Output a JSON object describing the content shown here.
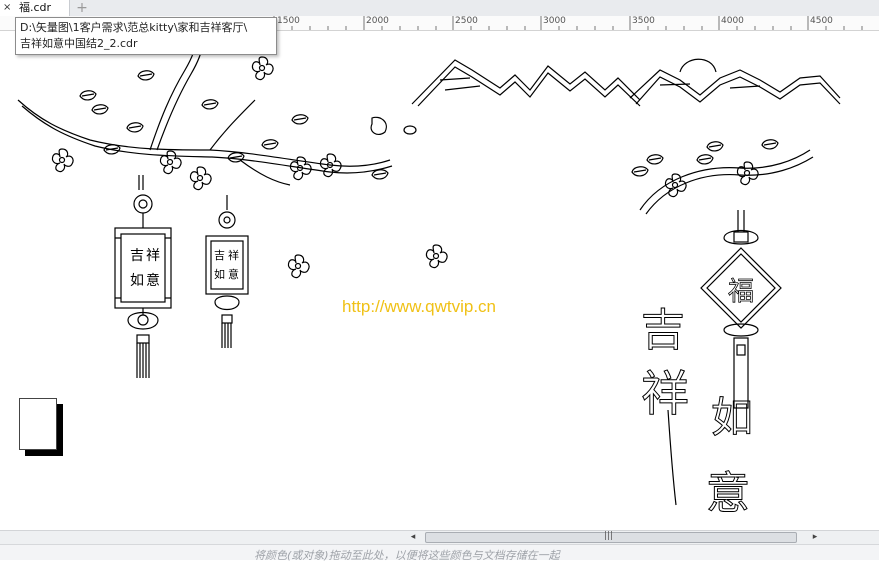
{
  "tab": {
    "title": "福.cdr",
    "close": "×",
    "add": "+"
  },
  "tooltip": {
    "line1": "D:\\矢量图\\1客户需求\\范总kitty\\家和吉祥客厅\\",
    "line2": "吉祥如意中国结2_2.cdr"
  },
  "ruler": {
    "labels": [
      "1500",
      "2000",
      "2500",
      "3000",
      "3500",
      "4000",
      "4500"
    ]
  },
  "watermark": "http://www.qwtvip.cn",
  "artwork": {
    "char_fu": "福",
    "calligraphy": [
      "吉",
      "祥",
      "如",
      "意"
    ],
    "lantern_left": [
      "吉",
      "祥",
      "如",
      "意"
    ],
    "lantern_right": [
      "吉",
      "祥",
      "如",
      "意"
    ]
  },
  "scrollbar": {
    "left_arrow": "◂",
    "right_arrow": "▸",
    "grip": "|||"
  },
  "status": {
    "color_hint": "将颜色(或对象)拖动至此处，以便将这些颜色与文档存储在一起"
  }
}
